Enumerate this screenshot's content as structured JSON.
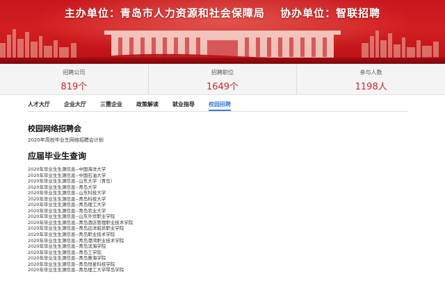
{
  "banner": {
    "host_label": "主办单位：青岛市人力资源和社会保障局",
    "co_label": "协办单位：智联招聘"
  },
  "stats": [
    {
      "label": "招聘公司",
      "value": "819个"
    },
    {
      "label": "招聘职位",
      "value": "1649个"
    },
    {
      "label": "参与人数",
      "value": "1198人"
    }
  ],
  "nav": {
    "tabs": [
      "人才大厅",
      "企业大厅",
      "三需企业",
      "政策解读",
      "就业指导",
      "校园招聘"
    ],
    "active_index": 5,
    "active_color": "#3b7bd8"
  },
  "content": {
    "heading": "校园网络招聘会",
    "subtitle": "2020年高校毕业生网络招聘会计划",
    "section_title": "应届毕业生查询",
    "items": [
      "2020年毕业生生源信息--中国海洋大学",
      "2020年毕业生生源信息--中国石油大学",
      "2020年毕业生生源信息--山东大学（青岛）",
      "2020年毕业生生源信息--青岛大学",
      "2020年毕业生生源信息--山东科技大学",
      "2020年毕业生生源信息--青岛科技大学",
      "2020年毕业生生源信息--青岛理工大学",
      "2020年毕业生生源信息--青岛农业大学",
      "2020年毕业生生源信息--山东外贸职业学院",
      "2020年毕业生生源信息--青岛酒店管理职业技术学院",
      "2020年毕业生生源信息--青岛远洋船员职业学院",
      "2020年毕业生生源信息--青岛职业技术学院",
      "2020年毕业生生源信息--青岛港湾职业技术学院",
      "2020年毕业生生源信息--青岛滨海学院",
      "2020年毕业生生源信息--青岛工学院",
      "2020年毕业生生源信息--青岛黄海学院",
      "2020年毕业生生源信息--青岛恒星科技学院",
      "2020年毕业生生源信息--青岛理工大学琴岛学院"
    ]
  },
  "colors": {
    "banner_red": "#c8141a",
    "stat_value": "#d1262b"
  }
}
